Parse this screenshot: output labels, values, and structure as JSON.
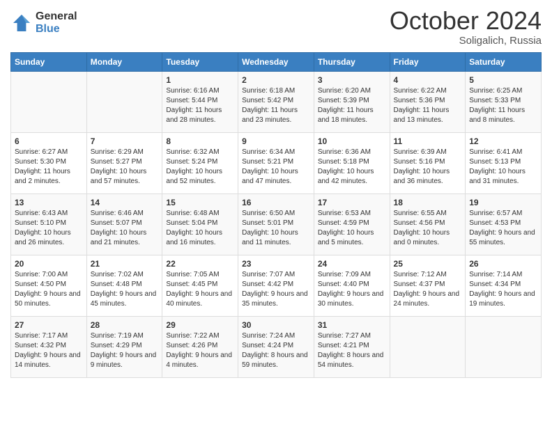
{
  "logo": {
    "general": "General",
    "blue": "Blue"
  },
  "title": "October 2024",
  "subtitle": "Soligalich, Russia",
  "days_header": [
    "Sunday",
    "Monday",
    "Tuesday",
    "Wednesday",
    "Thursday",
    "Friday",
    "Saturday"
  ],
  "weeks": [
    [
      {
        "day": "",
        "info": ""
      },
      {
        "day": "",
        "info": ""
      },
      {
        "day": "1",
        "info": "Sunrise: 6:16 AM\nSunset: 5:44 PM\nDaylight: 11 hours and 28 minutes."
      },
      {
        "day": "2",
        "info": "Sunrise: 6:18 AM\nSunset: 5:42 PM\nDaylight: 11 hours and 23 minutes."
      },
      {
        "day": "3",
        "info": "Sunrise: 6:20 AM\nSunset: 5:39 PM\nDaylight: 11 hours and 18 minutes."
      },
      {
        "day": "4",
        "info": "Sunrise: 6:22 AM\nSunset: 5:36 PM\nDaylight: 11 hours and 13 minutes."
      },
      {
        "day": "5",
        "info": "Sunrise: 6:25 AM\nSunset: 5:33 PM\nDaylight: 11 hours and 8 minutes."
      }
    ],
    [
      {
        "day": "6",
        "info": "Sunrise: 6:27 AM\nSunset: 5:30 PM\nDaylight: 11 hours and 2 minutes."
      },
      {
        "day": "7",
        "info": "Sunrise: 6:29 AM\nSunset: 5:27 PM\nDaylight: 10 hours and 57 minutes."
      },
      {
        "day": "8",
        "info": "Sunrise: 6:32 AM\nSunset: 5:24 PM\nDaylight: 10 hours and 52 minutes."
      },
      {
        "day": "9",
        "info": "Sunrise: 6:34 AM\nSunset: 5:21 PM\nDaylight: 10 hours and 47 minutes."
      },
      {
        "day": "10",
        "info": "Sunrise: 6:36 AM\nSunset: 5:18 PM\nDaylight: 10 hours and 42 minutes."
      },
      {
        "day": "11",
        "info": "Sunrise: 6:39 AM\nSunset: 5:16 PM\nDaylight: 10 hours and 36 minutes."
      },
      {
        "day": "12",
        "info": "Sunrise: 6:41 AM\nSunset: 5:13 PM\nDaylight: 10 hours and 31 minutes."
      }
    ],
    [
      {
        "day": "13",
        "info": "Sunrise: 6:43 AM\nSunset: 5:10 PM\nDaylight: 10 hours and 26 minutes."
      },
      {
        "day": "14",
        "info": "Sunrise: 6:46 AM\nSunset: 5:07 PM\nDaylight: 10 hours and 21 minutes."
      },
      {
        "day": "15",
        "info": "Sunrise: 6:48 AM\nSunset: 5:04 PM\nDaylight: 10 hours and 16 minutes."
      },
      {
        "day": "16",
        "info": "Sunrise: 6:50 AM\nSunset: 5:01 PM\nDaylight: 10 hours and 11 minutes."
      },
      {
        "day": "17",
        "info": "Sunrise: 6:53 AM\nSunset: 4:59 PM\nDaylight: 10 hours and 5 minutes."
      },
      {
        "day": "18",
        "info": "Sunrise: 6:55 AM\nSunset: 4:56 PM\nDaylight: 10 hours and 0 minutes."
      },
      {
        "day": "19",
        "info": "Sunrise: 6:57 AM\nSunset: 4:53 PM\nDaylight: 9 hours and 55 minutes."
      }
    ],
    [
      {
        "day": "20",
        "info": "Sunrise: 7:00 AM\nSunset: 4:50 PM\nDaylight: 9 hours and 50 minutes."
      },
      {
        "day": "21",
        "info": "Sunrise: 7:02 AM\nSunset: 4:48 PM\nDaylight: 9 hours and 45 minutes."
      },
      {
        "day": "22",
        "info": "Sunrise: 7:05 AM\nSunset: 4:45 PM\nDaylight: 9 hours and 40 minutes."
      },
      {
        "day": "23",
        "info": "Sunrise: 7:07 AM\nSunset: 4:42 PM\nDaylight: 9 hours and 35 minutes."
      },
      {
        "day": "24",
        "info": "Sunrise: 7:09 AM\nSunset: 4:40 PM\nDaylight: 9 hours and 30 minutes."
      },
      {
        "day": "25",
        "info": "Sunrise: 7:12 AM\nSunset: 4:37 PM\nDaylight: 9 hours and 24 minutes."
      },
      {
        "day": "26",
        "info": "Sunrise: 7:14 AM\nSunset: 4:34 PM\nDaylight: 9 hours and 19 minutes."
      }
    ],
    [
      {
        "day": "27",
        "info": "Sunrise: 7:17 AM\nSunset: 4:32 PM\nDaylight: 9 hours and 14 minutes."
      },
      {
        "day": "28",
        "info": "Sunrise: 7:19 AM\nSunset: 4:29 PM\nDaylight: 9 hours and 9 minutes."
      },
      {
        "day": "29",
        "info": "Sunrise: 7:22 AM\nSunset: 4:26 PM\nDaylight: 9 hours and 4 minutes."
      },
      {
        "day": "30",
        "info": "Sunrise: 7:24 AM\nSunset: 4:24 PM\nDaylight: 8 hours and 59 minutes."
      },
      {
        "day": "31",
        "info": "Sunrise: 7:27 AM\nSunset: 4:21 PM\nDaylight: 8 hours and 54 minutes."
      },
      {
        "day": "",
        "info": ""
      },
      {
        "day": "",
        "info": ""
      }
    ]
  ]
}
